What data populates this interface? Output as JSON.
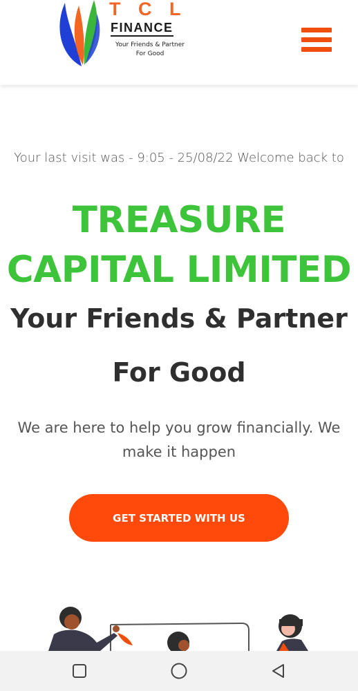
{
  "header": {
    "logo": {
      "brand": "T C L",
      "finance": "FINANCE",
      "tagline_line1": "Your Friends & Partner",
      "tagline_line2": "For Good"
    },
    "menu_icon": "hamburger-menu-icon"
  },
  "hero": {
    "last_visit": "Your last visit was - 9:05 - 25/08/22 Welcome back to",
    "title": "TREASURE CAPITAL LIMITED",
    "subtitle": "Your Friends & Partner For Good",
    "description": "We are here to help you grow financially. We make it happen",
    "cta_label": "GET STARTED WITH US"
  },
  "navbar": {
    "recent_icon": "square-recents-icon",
    "home_icon": "circle-home-icon",
    "back_icon": "triangle-back-icon"
  },
  "colors": {
    "accent": "#ff4a0b",
    "title_green": "#3ec43a",
    "text_dark": "#2f2f2f"
  }
}
